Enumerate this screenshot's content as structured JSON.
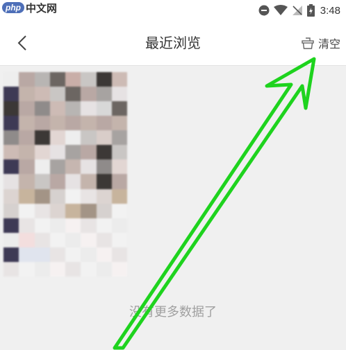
{
  "watermark": {
    "logo": "php",
    "text": "中文网"
  },
  "status_bar": {
    "time": "3:48",
    "icons": [
      "do-not-disturb-icon",
      "wifi-icon",
      "no-signal-icon",
      "battery-icon"
    ]
  },
  "header": {
    "title": "最近浏览",
    "back_icon": "chevron-left-icon",
    "clear_icon": "basket-icon",
    "clear_label": "清空"
  },
  "list": {
    "end_text": "没有更多数据了"
  },
  "annotation": {
    "color": "#1ed31e",
    "shape": "arrow",
    "points_to": "clear-button"
  }
}
